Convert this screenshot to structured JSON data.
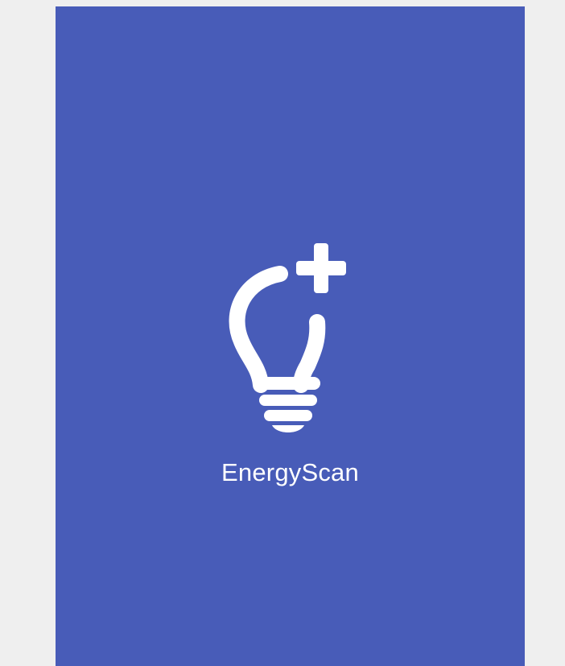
{
  "app": {
    "name": "EnergyScan"
  },
  "logo": {
    "icon": "lightbulb-plus-icon"
  },
  "colors": {
    "background": "#485cb8",
    "page": "#efefef",
    "foreground": "#ffffff"
  }
}
